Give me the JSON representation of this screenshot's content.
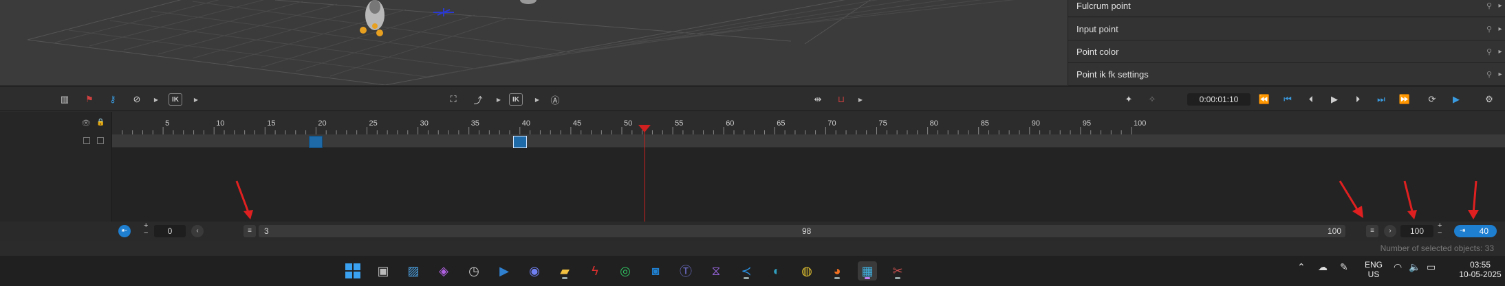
{
  "properties_panel": {
    "rows": [
      {
        "label": "Fulcrum point"
      },
      {
        "label": "Input point"
      },
      {
        "label": "Point color"
      },
      {
        "label": "Point ik fk settings"
      }
    ]
  },
  "toolbar": {
    "ik_label": "IK",
    "time": "0:00:01:10"
  },
  "timeline": {
    "ruler_labels": [
      "5",
      "10",
      "15",
      "20",
      "25",
      "30",
      "35",
      "40",
      "45",
      "50",
      "55",
      "60",
      "65",
      "70",
      "75",
      "80",
      "85",
      "90",
      "95",
      "100"
    ],
    "current_frame": 40,
    "keyframes": [
      20,
      40
    ]
  },
  "bottom_bar": {
    "start_value": "0",
    "step_value": "3",
    "center_value": "98",
    "end_value": "100",
    "range_end": "100",
    "current_value": "40"
  },
  "status": {
    "selected_objects": "Number of selected objects: 33"
  },
  "taskbar": {
    "language": "ENG",
    "region": "US",
    "time": "03:55",
    "date": "10-05-2025"
  },
  "colors": {
    "accent": "#3a9be0",
    "playhead": "#d02020",
    "annotation": "#e02020"
  }
}
